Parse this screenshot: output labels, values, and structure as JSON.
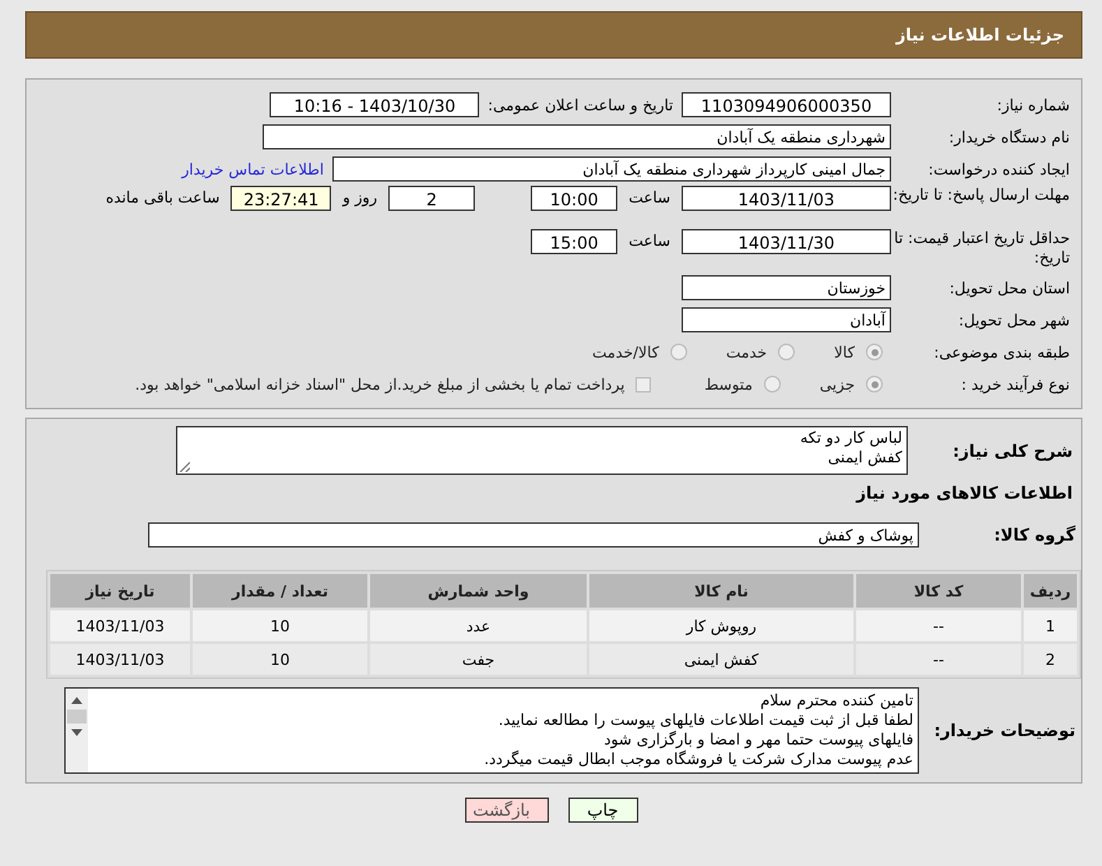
{
  "title": "جزئیات اطلاعات نیاز",
  "need_number": {
    "label": "شماره نیاز:",
    "value": "1103094906000350"
  },
  "announce": {
    "label": "تاریخ و ساعت اعلان عمومی:",
    "value": "1403/10/30 - 10:16"
  },
  "buyer": {
    "label": "نام دستگاه خریدار:",
    "value": "شهرداری منطقه یک آبادان"
  },
  "creator": {
    "label": "ایجاد کننده درخواست:",
    "value": "جمال امینی کارپرداز شهرداری منطقه یک آبادان",
    "link": "اطلاعات تماس خریدار"
  },
  "reply_deadline": {
    "label": "مهلت ارسال پاسخ: تا تاریخ:",
    "date": "1403/11/03",
    "time_label": "ساعت",
    "time": "10:00",
    "days": "2",
    "days_label": "روز و",
    "remaining": "23:27:41",
    "remaining_label": "ساعت باقی مانده"
  },
  "price_validity": {
    "label": "حداقل تاریخ اعتبار قیمت: تا تاریخ:",
    "date": "1403/11/30",
    "time_label": "ساعت",
    "time": "15:00"
  },
  "province": {
    "label": "استان محل تحویل:",
    "value": "خوزستان"
  },
  "city": {
    "label": "شهر محل تحویل:",
    "value": "آبادان"
  },
  "category": {
    "label": "طبقه بندی موضوعی:",
    "options": [
      {
        "label": "کالا",
        "selected": true
      },
      {
        "label": "خدمت",
        "selected": false
      },
      {
        "label": "کالا/خدمت",
        "selected": false
      }
    ]
  },
  "process": {
    "label": "نوع فرآیند خرید :",
    "options": [
      {
        "label": "جزیی",
        "selected": true
      },
      {
        "label": "متوسط",
        "selected": false
      }
    ],
    "payment": {
      "label": "پرداخت تمام یا بخشی از مبلغ خرید.از محل \"اسناد خزانه اسلامی\" خواهد بود.",
      "checked": false
    }
  },
  "description": {
    "label": "شرح کلی نیاز:",
    "lines": [
      "لباس کار دو تکه",
      "کفش ایمنی"
    ]
  },
  "goods_heading": "اطلاعات کالاهای مورد نیاز",
  "goods_group": {
    "label": "گروه کالا:",
    "value": "پوشاک و کفش"
  },
  "table": {
    "columns": [
      "ردیف",
      "کد کالا",
      "نام کالا",
      "واحد شمارش",
      "تعداد / مقدار",
      "تاریخ نیاز"
    ],
    "rows": [
      [
        "1",
        "--",
        "روپوش کار",
        "عدد",
        "10",
        "1403/11/03"
      ],
      [
        "2",
        "--",
        "کفش ایمنی",
        "جفت",
        "10",
        "1403/11/03"
      ]
    ]
  },
  "buyer_notes": {
    "label": "توضیحات خریدار:",
    "lines": [
      "تامین کننده محترم سلام",
      "لطفا قبل از ثبت قیمت اطلاعات فایلهای پیوست را مطالعه نمایید.",
      "فایلهای پیوست حتما مهر و امضا و بارگزاری شود",
      "عدم پیوست مدارک شرکت یا فروشگاه موجب ابطال قیمت میگردد."
    ]
  },
  "buttons": [
    {
      "kind": "print",
      "label": "چاپ"
    },
    {
      "kind": "back",
      "label": "بازگشت"
    }
  ]
}
